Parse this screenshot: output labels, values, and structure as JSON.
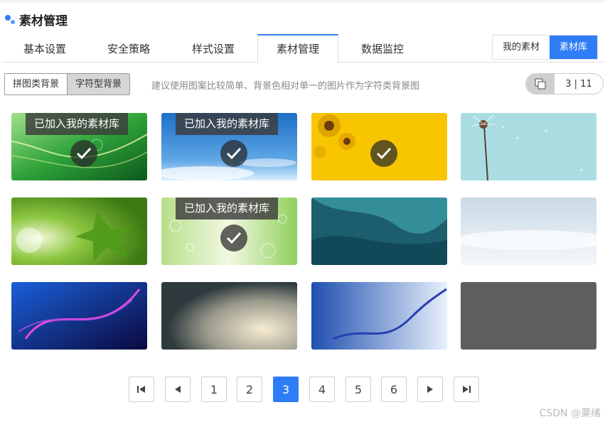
{
  "header": {
    "title": "素材管理"
  },
  "tabs": [
    {
      "label": "基本设置"
    },
    {
      "label": "安全策略"
    },
    {
      "label": "样式设置"
    },
    {
      "label": "素材管理"
    },
    {
      "label": "数据监控"
    }
  ],
  "library_toggle": {
    "mine": "我的素材",
    "library": "素材库",
    "selected": "素材库"
  },
  "background_type": {
    "puzzle": "拼图类背景",
    "character": "字符型背景",
    "selected": "字符型背景"
  },
  "hint": "建议使用图案比较简单、背景色相对单一的图片作为字符类背景图",
  "counter": {
    "icon": "copy-icon",
    "text": "3 | 11"
  },
  "added_badge": "已加入我的素材库",
  "cards": [
    {
      "theme": "green-lines",
      "added": true
    },
    {
      "theme": "blue-sky",
      "added": true
    },
    {
      "theme": "sunflowers",
      "added": true
    },
    {
      "theme": "dandelion",
      "added": false
    },
    {
      "theme": "maple-leaves",
      "added": false
    },
    {
      "theme": "bubbles",
      "added": true
    },
    {
      "theme": "teal-waves",
      "added": false
    },
    {
      "theme": "snow-sky",
      "added": false
    },
    {
      "theme": "purple-swirl",
      "added": false
    },
    {
      "theme": "beige-light",
      "added": false
    },
    {
      "theme": "blue-mosaic-wave",
      "added": false
    },
    {
      "theme": "gray-texture",
      "added": false
    }
  ],
  "pagination": {
    "pages": [
      "1",
      "2",
      "3",
      "4",
      "5",
      "6"
    ],
    "current": "3"
  },
  "colors": {
    "accent": "#2f7df6"
  },
  "watermark": "CSDN @薬绪"
}
